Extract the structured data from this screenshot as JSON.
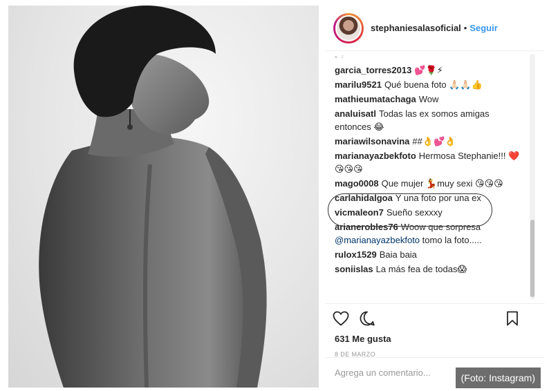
{
  "post": {
    "username": "stephaniesalasoficial",
    "separator": "•",
    "follow_label": "Seguir",
    "scroll_hint": "▪ ♀",
    "likes": "631 Me gusta",
    "date": "8 DE MARZO",
    "add_comment_placeholder": "Agrega un comentario..."
  },
  "comments": [
    {
      "user": "garcia_torres2013",
      "text": "💕🌹⚡"
    },
    {
      "user": "marilu9521",
      "text": "Qué buena foto 🙏🏻🙏🏻👍"
    },
    {
      "user": "mathieumatachaga",
      "text": "Wow"
    },
    {
      "user": "analuisatl",
      "text": "Todas las ex somos amigas entonces 😂"
    },
    {
      "user": "mariawilsonavina",
      "text": "##👌💕👌"
    },
    {
      "user": "marianayazbekfoto",
      "text": "Hermosa Stephanie!!! ❤️😘😘😘"
    },
    {
      "user": "mago0008",
      "text": "Que mujer 💃muy sexi 😘😘😘"
    },
    {
      "user": "carlahidalgoa",
      "text": "Y una foto por una ex"
    },
    {
      "user": "vicmaleon7",
      "text": "Sueño sexxxy"
    },
    {
      "user": "arianerobles76",
      "text": "Woow que sorpresa",
      "mention": "@marianayazbekfoto",
      "after_mention": "tomo la foto....."
    },
    {
      "user": "rulox1529",
      "text": "Baia baia"
    },
    {
      "user": "soniislas",
      "text": "La más fea de todas😱"
    }
  ],
  "credit": "(Foto: Instagram)",
  "icons": {
    "like": "heart-icon",
    "comment": "comment-bubble-icon",
    "save": "bookmark-icon"
  },
  "colors": {
    "follow": "#3897f0",
    "highlight_ring": "#333333",
    "credit_bg": "#6d6d6d"
  }
}
